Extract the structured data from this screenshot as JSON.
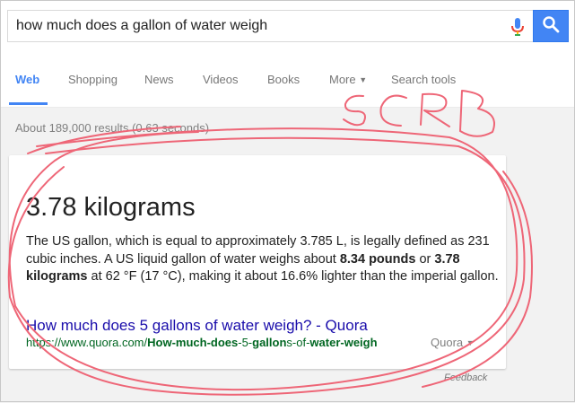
{
  "search": {
    "query": "how much does a gallon of water weigh"
  },
  "tabs": [
    "Web",
    "Shopping",
    "News",
    "Videos",
    "Books",
    "More",
    "Search tools"
  ],
  "stats": "About 189,000 results (0.63 seconds)",
  "answer": {
    "headline": "3.78 kilograms",
    "desc_1": "The US gallon, which is equal to approximately 3.785 L, is legally defined as 231 cubic inches. A US liquid gallon of water weighs about ",
    "pounds": "8.34 pounds",
    "or": " or ",
    "kilos": "3.78 kilograms",
    "desc_2": " at 62 °F (17 °C), making it about 16.6% lighter than the imperial gallon."
  },
  "result": {
    "title": "How much does 5 gallons of water weigh? - Quora",
    "url_1": "https://www.quora.com/",
    "url_b1": "How-much-does",
    "url_2": "-5-",
    "url_b2": "gallon",
    "url_3": "s-of-",
    "url_b3": "water-weigh",
    "source": "Quora"
  },
  "feedback": "Feedback",
  "annotation": "SCRB",
  "colors": {
    "accent": "#4285f4",
    "link": "#1a0dab",
    "url": "#006621",
    "scribble": "#ee6677"
  }
}
